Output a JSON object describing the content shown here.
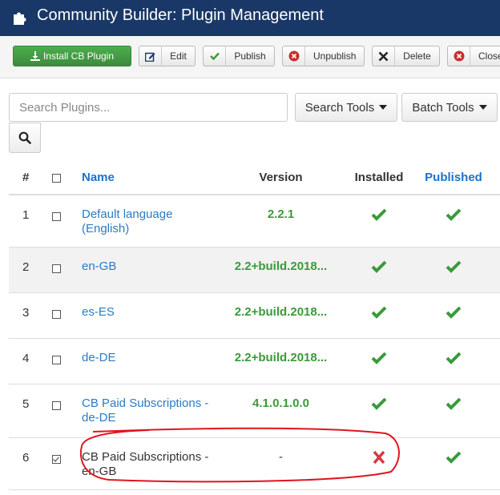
{
  "header": {
    "title": "Community Builder: Plugin Management",
    "icon": "puzzle-icon"
  },
  "toolbar": {
    "install_label": "Install CB Plugin",
    "edit_label": "Edit",
    "publish_label": "Publish",
    "unpublish_label": "Unpublish",
    "delete_label": "Delete",
    "close_label": "Close"
  },
  "filters": {
    "search_placeholder": "Search Plugins...",
    "search_tools_label": "Search Tools",
    "batch_tools_label": "Batch Tools"
  },
  "table": {
    "headers": {
      "num": "#",
      "name": "Name",
      "version": "Version",
      "installed": "Installed",
      "published": "Published"
    },
    "rows": [
      {
        "num": "1",
        "name": "Default language (English)",
        "version": "2.2.1",
        "installed": true,
        "published": true,
        "checked": false
      },
      {
        "num": "2",
        "name": "en-GB",
        "version": "2.2+build.2018...",
        "installed": true,
        "published": true,
        "checked": false
      },
      {
        "num": "3",
        "name": "es-ES",
        "version": "2.2+build.2018...",
        "installed": true,
        "published": true,
        "checked": false
      },
      {
        "num": "4",
        "name": "de-DE",
        "version": "2.2+build.2018...",
        "installed": true,
        "published": true,
        "checked": false
      },
      {
        "num": "5",
        "name": "CB Paid Subscriptions - de-DE",
        "version": "4.1.0.1.0.0",
        "installed": true,
        "published": true,
        "checked": false
      },
      {
        "num": "6",
        "name": "CB Paid Subscriptions - en-GB",
        "version": "-",
        "installed": false,
        "published": true,
        "checked": true
      }
    ]
  },
  "colors": {
    "header_bg": "#1a3867",
    "install_green": "#46a546",
    "link_blue": "#2a7bc6",
    "check_green": "#3a9a3a",
    "cross_red": "#d9363e",
    "annotation_red": "#e0141e"
  }
}
